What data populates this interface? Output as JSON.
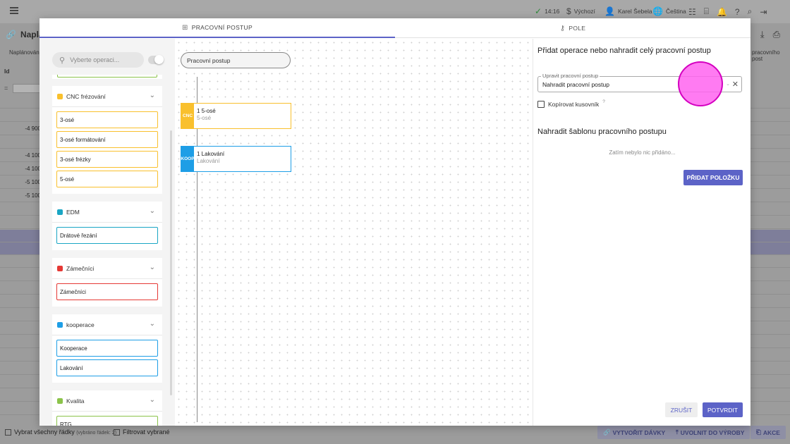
{
  "background": {
    "status": {
      "time": "14:16",
      "env": "Výchozí",
      "user": "Karel Šebela",
      "language": "Čeština"
    },
    "page_title": "Napláno",
    "column_header": "Naplánován",
    "column_header_right": "pracovního post",
    "id_header": "Id",
    "filter_symbol": "=",
    "row_values": [
      "-4 900",
      "-4 100",
      "-4 100",
      "-5 100",
      "-5 100"
    ],
    "bottom": {
      "select_all": "Vybrat všechny řádky",
      "selected_count": "(vybráno řádek: 2)",
      "filter_selected": "Filtrovat vybrané",
      "create_batches": "VYTVOŘIT DÁVKY",
      "release": "UVOLNIT DO VÝROBY",
      "actions": "AKCE"
    }
  },
  "modal": {
    "tabs": [
      {
        "label": "PRACOVNÍ POSTUP",
        "icon": "sitemap-icon",
        "active": true
      },
      {
        "label": "POLE",
        "icon": "key-icon",
        "active": false
      }
    ],
    "left": {
      "search_placeholder": "Vyberte operaci...",
      "categories": [
        {
          "name": "CNC frézování",
          "color": "#f9c02d",
          "ops": [
            "3-osé",
            "3-osé formátování",
            "3-osé frézky",
            "5-osé"
          ]
        },
        {
          "name": "EDM",
          "color": "#1aa6c4",
          "ops": [
            "Drátové řezání"
          ]
        },
        {
          "name": "Zámečníci",
          "color": "#e53935",
          "ops": [
            "Zámečníci"
          ]
        },
        {
          "name": "kooperace",
          "color": "#1e9ee6",
          "ops": [
            "Kooperace",
            "Lakování"
          ]
        },
        {
          "name": "Kvalita",
          "color": "#8bc34a",
          "ops": [
            "RTG"
          ]
        }
      ]
    },
    "canvas": {
      "workflow_label": "Pracovní postup",
      "nodes": [
        {
          "tag": "CNC",
          "line1": "1 5-osé",
          "line2": "5-osé",
          "color": "#f9c02d"
        },
        {
          "tag": "KOOP",
          "line1": "1 Lakování",
          "line2": "Lakování",
          "color": "#1e9ee6"
        }
      ]
    },
    "right": {
      "heading": "Přidat operace nebo nahradit celý pracovní postup",
      "field_label": "Upravit pracovní postup",
      "field_value": "Nahradit pracovní postup",
      "copy_bom": "Kopírovat kusovník",
      "help_mark": "?",
      "template_heading": "Nahradit šablonu pracovního postupu",
      "empty_text": "Zatím nebylo nic přidáno...",
      "add_item": "PŘIDAT POLOŽKU",
      "cancel": "ZRUŠIT",
      "confirm": "POTVRDIT"
    }
  }
}
